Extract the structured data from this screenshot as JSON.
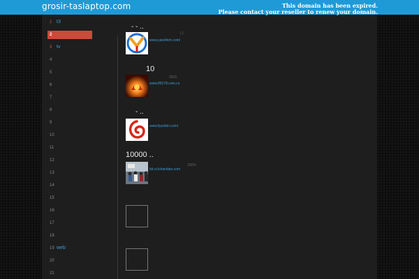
{
  "header": {
    "site_title": "grosir-taslaptop.com",
    "expired_line1": "This domain has been expired.",
    "expired_line2": "Please contact your reseller to renew your domain.",
    "bar_color": "#1f9ad6"
  },
  "sidebar": {
    "items": [
      {
        "num": "1",
        "label": "t3"
      },
      {
        "num": "2",
        "label": ""
      },
      {
        "num": "3",
        "label": "tv"
      },
      {
        "num": "4",
        "label": ""
      },
      {
        "num": "5",
        "label": ""
      },
      {
        "num": "6",
        "label": ""
      },
      {
        "num": "7",
        "label": ""
      },
      {
        "num": "8",
        "label": ""
      },
      {
        "num": "9",
        "label": ""
      },
      {
        "num": "10",
        "label": ""
      },
      {
        "num": "11",
        "label": ""
      },
      {
        "num": "12",
        "label": ""
      },
      {
        "num": "13",
        "label": ""
      },
      {
        "num": "14",
        "label": ""
      },
      {
        "num": "15",
        "label": ""
      },
      {
        "num": "16",
        "label": ""
      },
      {
        "num": "17",
        "label": ""
      },
      {
        "num": "18",
        "label": ""
      },
      {
        "num": "19",
        "label": "web"
      },
      {
        "num": "20",
        "label": ""
      },
      {
        "num": "21",
        "label": ""
      }
    ],
    "active_color": "#cc4a3a"
  },
  "main": {
    "items": [
      {
        "title": "-  -  ..",
        "url": "www.yaoshkm.com/",
        "meta": "(  )",
        "logo": "yk-logo-icon"
      },
      {
        "title": "10",
        "url": "www.89178.com.cn",
        "meta": "2016",
        "logo": "flame-logo-icon"
      },
      {
        "title": "-  ..",
        "url": "www.liyunbin.com/",
        "meta": "",
        "logo": "swirl-logo-icon"
      },
      {
        "title": "10000  ..",
        "url": "bit.cc/chandian.com",
        "meta": "100%",
        "logo": "crowd-photo-icon"
      }
    ]
  }
}
